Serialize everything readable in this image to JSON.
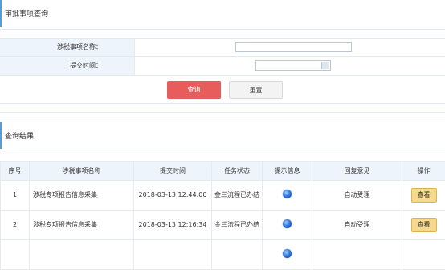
{
  "query_section": {
    "title": "审批事项查询"
  },
  "form": {
    "item_name_label": "涉税事项名称：",
    "item_name_value": "",
    "submit_time_label": "提交时间：",
    "submit_time_value": "",
    "query_button": "查询",
    "reset_button": "重置"
  },
  "results_section": {
    "title": "查询结果"
  },
  "table": {
    "headers": [
      "序号",
      "涉税事项名称",
      "提交时间",
      "任务状态",
      "提示信息",
      "回复意见",
      "操作"
    ],
    "rows": [
      {
        "index": "1",
        "name": "涉税专项报告信息采集",
        "time": "2018-03-13 12:44:00",
        "status": "金三流程已办结",
        "reply": "自动受理",
        "action": "查看"
      },
      {
        "index": "2",
        "name": "涉税专项报告信息采集",
        "time": "2018-03-13 12:16:34",
        "status": "金三流程已办结",
        "reply": "自动受理",
        "action": "查看"
      }
    ]
  }
}
